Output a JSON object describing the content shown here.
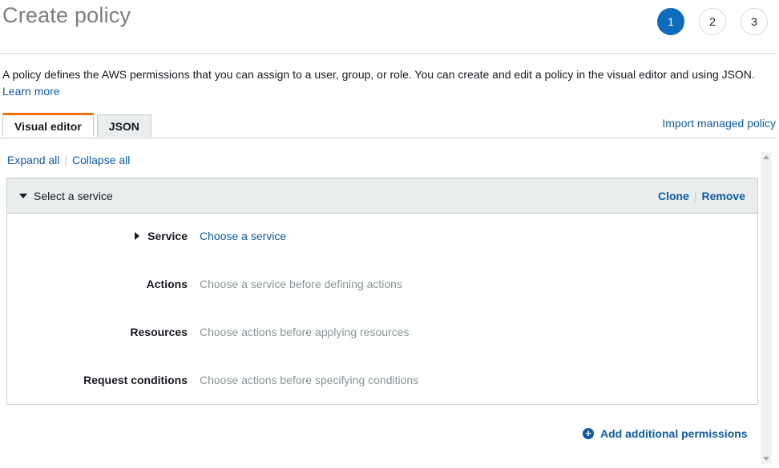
{
  "header": {
    "title": "Create policy",
    "steps": [
      "1",
      "2",
      "3"
    ],
    "active_step": "1"
  },
  "description": {
    "text": "A policy defines the AWS permissions that you can assign to a user, group, or role. You can create and edit a policy in the visual editor and using JSON.",
    "learn_more": "Learn more"
  },
  "tabs": [
    {
      "label": "Visual editor",
      "active": true
    },
    {
      "label": "JSON",
      "active": false
    }
  ],
  "import_link": "Import managed policy",
  "expand_all": "Expand all",
  "collapse_all": "Collapse all",
  "panel": {
    "title": "Select a service",
    "clone": "Clone",
    "remove": "Remove",
    "fields": [
      {
        "label": "Service",
        "value": "Choose a service"
      },
      {
        "label": "Actions",
        "value": "Choose a service before defining actions"
      },
      {
        "label": "Resources",
        "value": "Choose actions before applying resources"
      },
      {
        "label": "Request conditions",
        "value": "Choose actions before specifying conditions"
      }
    ]
  },
  "add_permissions": "Add additional permissions",
  "colors": {
    "accent": "#0f6cbd",
    "link": "#0e5b9e",
    "tab_highlight": "#ec7211"
  }
}
